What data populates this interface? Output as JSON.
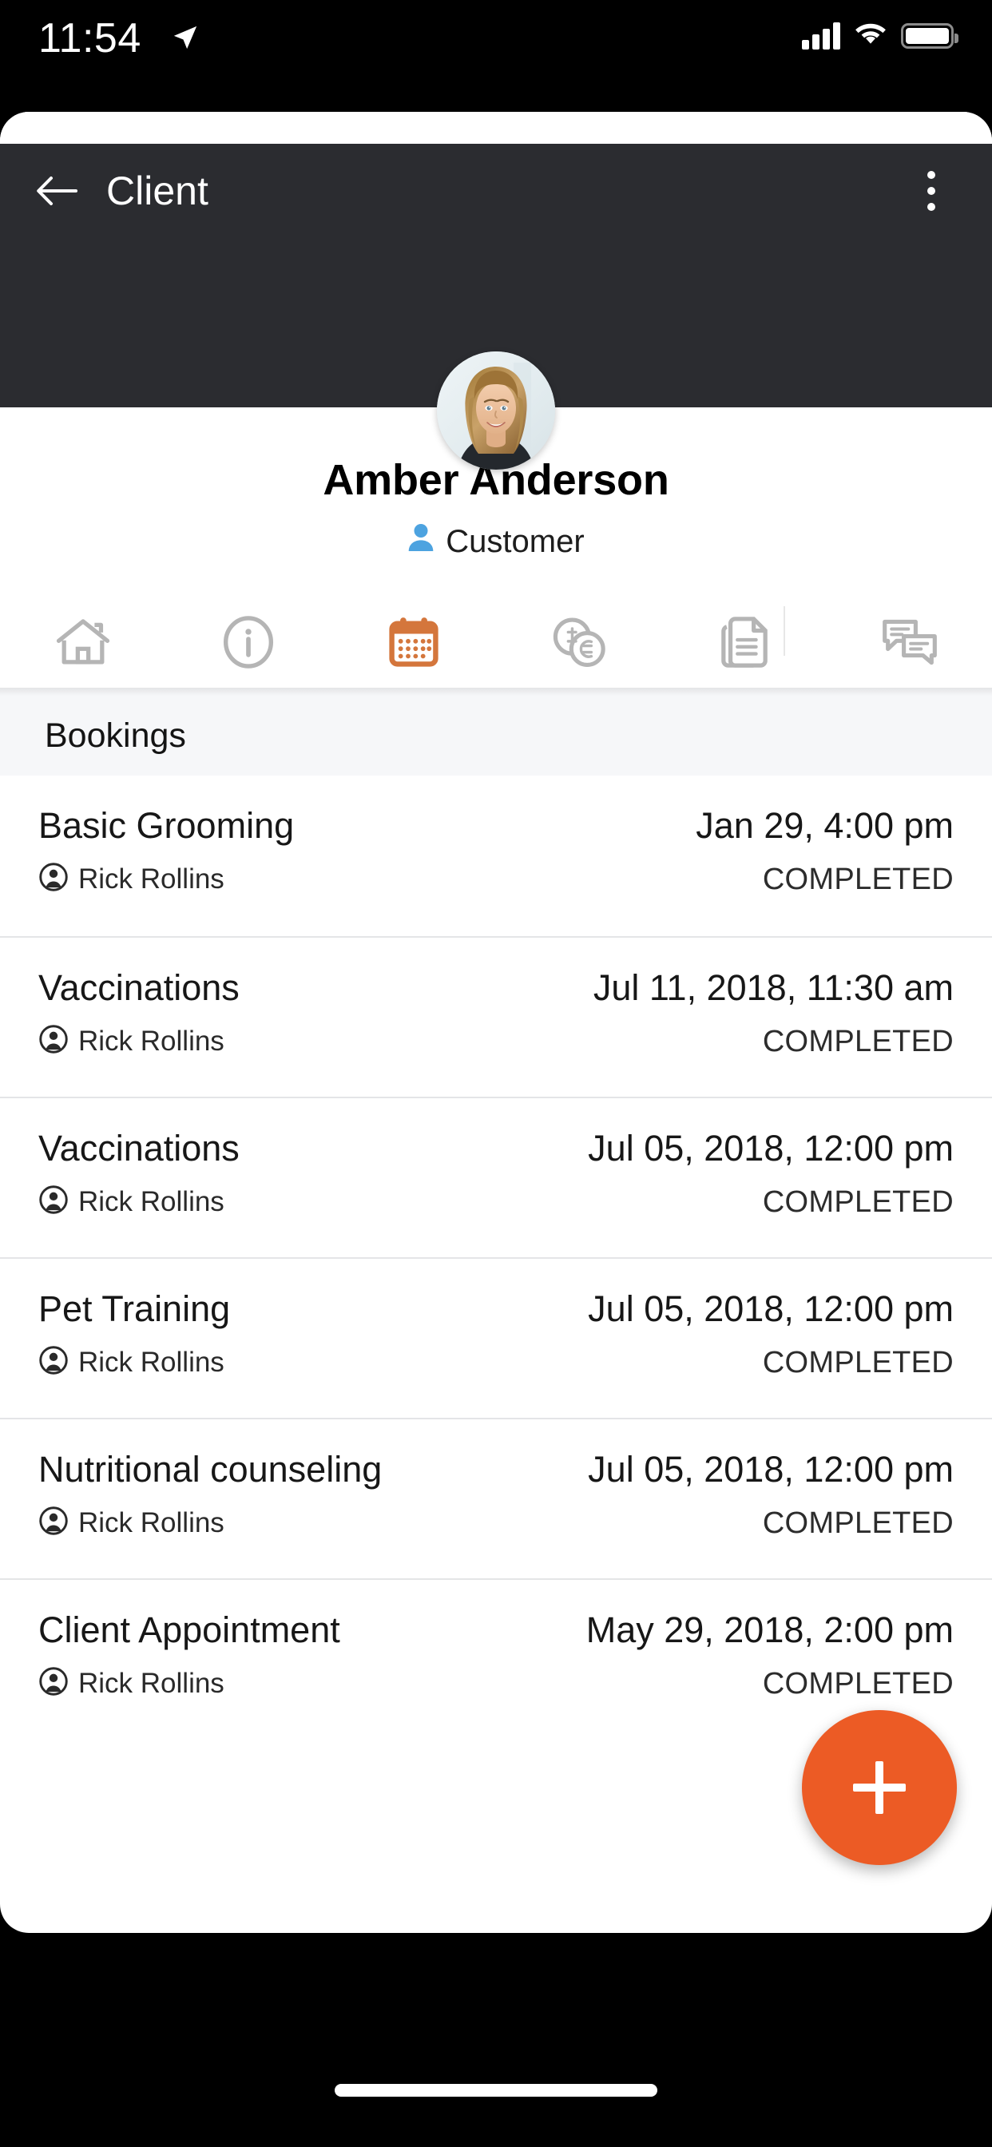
{
  "status_bar": {
    "time": "11:54",
    "location_icon": "location-arrow-icon",
    "signal_icon": "cellular-signal-icon",
    "wifi_icon": "wifi-icon",
    "battery_icon": "battery-full-icon"
  },
  "navbar": {
    "back_icon": "back-arrow-icon",
    "title": "Client",
    "overflow_icon": "more-vertical-icon",
    "background_color": "#2b2c30"
  },
  "profile": {
    "avatar_alt": "avatar-photo",
    "name": "Amber Anderson",
    "role": "Customer",
    "role_icon": "person-icon",
    "role_icon_color": "#4da3e0"
  },
  "tabs": {
    "active_index": 2,
    "accent_color": "#d4763c",
    "inactive_color": "#b5b5b5",
    "items": [
      {
        "name": "home",
        "icon": "home-icon"
      },
      {
        "name": "info",
        "icon": "info-circle-icon"
      },
      {
        "name": "bookings",
        "icon": "calendar-icon"
      },
      {
        "name": "payments",
        "icon": "coins-icon"
      },
      {
        "name": "documents",
        "icon": "documents-icon"
      },
      {
        "name": "messages",
        "icon": "chat-bubbles-icon"
      }
    ]
  },
  "section": {
    "title": "Bookings",
    "background_color": "#f6f7f9"
  },
  "bookings": [
    {
      "service": "Basic Grooming",
      "staff": "Rick Rollins",
      "datetime": "Jan 29, 4:00 pm",
      "status": "COMPLETED"
    },
    {
      "service": "Vaccinations",
      "staff": "Rick Rollins",
      "datetime": "Jul 11, 2018, 11:30 am",
      "status": "COMPLETED"
    },
    {
      "service": "Vaccinations",
      "staff": "Rick Rollins",
      "datetime": "Jul 05, 2018, 12:00 pm",
      "status": "COMPLETED"
    },
    {
      "service": "Pet Training",
      "staff": "Rick Rollins",
      "datetime": "Jul 05, 2018, 12:00 pm",
      "status": "COMPLETED"
    },
    {
      "service": "Nutritional counseling",
      "staff": "Rick Rollins",
      "datetime": "Jul 05, 2018, 12:00 pm",
      "status": "COMPLETED"
    },
    {
      "service": "Client Appointment",
      "staff": "Rick Rollins",
      "datetime": "May 29, 2018, 2:00 pm",
      "status": "COMPLETED"
    }
  ],
  "fab": {
    "icon": "plus-icon",
    "color": "#ec5b25"
  }
}
